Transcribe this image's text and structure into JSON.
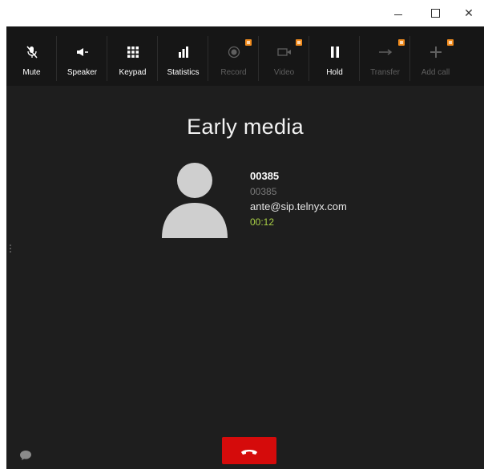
{
  "window": {
    "minimize_icon": "minimize-icon",
    "maximize_icon": "maximize-icon",
    "close_glyph": "✕"
  },
  "toolbar": {
    "items": [
      {
        "label": "Mute",
        "icon": "microphone-muted-icon",
        "enabled": true,
        "badge": false
      },
      {
        "label": "Speaker",
        "icon": "speaker-icon",
        "enabled": true,
        "badge": false
      },
      {
        "label": "Keypad",
        "icon": "keypad-icon",
        "enabled": true,
        "badge": false
      },
      {
        "label": "Statistics",
        "icon": "statistics-icon",
        "enabled": true,
        "badge": false
      },
      {
        "label": "Record",
        "icon": "record-icon",
        "enabled": false,
        "badge": true
      },
      {
        "label": "Video",
        "icon": "video-icon",
        "enabled": false,
        "badge": true
      },
      {
        "label": "Hold",
        "icon": "pause-icon",
        "enabled": true,
        "badge": false
      },
      {
        "label": "Transfer",
        "icon": "transfer-arrow-icon",
        "enabled": false,
        "badge": true
      },
      {
        "label": "Add call",
        "icon": "plus-icon",
        "enabled": false,
        "badge": true
      }
    ]
  },
  "call": {
    "status": "Early media",
    "name": "00385",
    "number": "00385",
    "uri": "ante@sip.telnyx.com",
    "duration": "00:12"
  },
  "colors": {
    "background": "#1e1e1e",
    "toolbar": "#161616",
    "duration": "#a9cf46",
    "hangup": "#d50b0b",
    "badge": "#f28c1e"
  }
}
